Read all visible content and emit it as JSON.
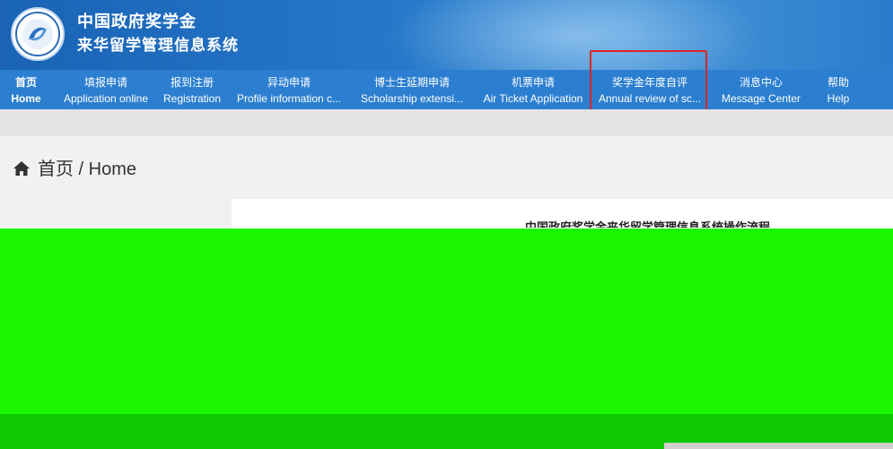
{
  "header": {
    "title_cn": "中国政府奖学金",
    "system_name": "来华留学管理信息系统",
    "logo": "china-scholarship-council-logo",
    "accent": "#2c7fd0"
  },
  "nav": {
    "items": [
      {
        "cn": "首页",
        "en": "Home"
      },
      {
        "cn": "填报申请",
        "en": "Application online"
      },
      {
        "cn": "报到注册",
        "en": "Registration"
      },
      {
        "cn": "异动申请",
        "en": "Profile information c..."
      },
      {
        "cn": "博士生延期申请",
        "en": "Scholarship extensi..."
      },
      {
        "cn": "机票申请",
        "en": "Air Ticket Application"
      },
      {
        "cn": "奖学金年度自评",
        "en": "Annual review of sc..."
      },
      {
        "cn": "消息中心",
        "en": "Message Center"
      },
      {
        "cn": "帮助",
        "en": "Help"
      }
    ],
    "highlight_color": "#e02424"
  },
  "breadcrumb": {
    "text": "首页 / Home",
    "icon": "home-icon"
  },
  "panel": {
    "title": "中国政府奖学金来华留学管理信息系统操作流程"
  },
  "overlay": {
    "color": "#1cf500"
  }
}
